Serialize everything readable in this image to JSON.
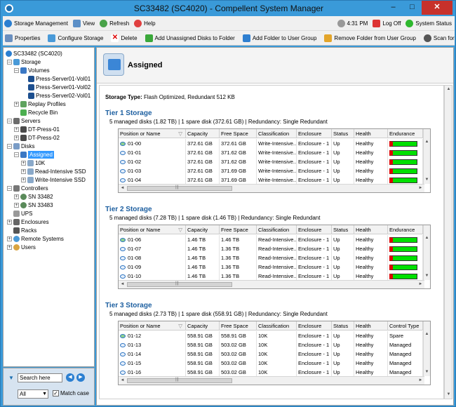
{
  "window": {
    "title": "SC33482 (SC4020) - Compellent System Manager"
  },
  "menu": {
    "storage_mgmt": "Storage Management",
    "view": "View",
    "refresh": "Refresh",
    "help": "Help",
    "time": "4:31 PM",
    "logoff": "Log Off",
    "system_status": "System Status"
  },
  "toolbar": {
    "properties": "Properties",
    "configure_storage": "Configure Storage",
    "delete": "Delete",
    "add_unassigned": "Add Unassigned Disks to Folder",
    "add_folder_user_group": "Add Folder to User Group",
    "remove_folder_user_group": "Remove Folder from User Group",
    "scan_disks": "Scan for Disks"
  },
  "tree": [
    {
      "label": "SC33482 (SC4020)",
      "icon": "system-icon"
    },
    {
      "label": "Storage",
      "icon": "storage-icon"
    },
    {
      "label": "Volumes",
      "icon": "folder-icon"
    },
    {
      "label": "Press-Server01-Vol01",
      "icon": "volume-icon"
    },
    {
      "label": "Press-Server01-Vol02",
      "icon": "volume-icon"
    },
    {
      "label": "Press-Server02-Vol01",
      "icon": "volume-icon"
    },
    {
      "label": "Replay Profiles",
      "icon": "replay-icon"
    },
    {
      "label": "Recycle Bin",
      "icon": "recycle-bin-icon"
    },
    {
      "label": "Servers",
      "icon": "servers-icon"
    },
    {
      "label": "DT-Press-01",
      "icon": "server-icon"
    },
    {
      "label": "DT-Press-02",
      "icon": "server-icon"
    },
    {
      "label": "Disks",
      "icon": "disks-icon"
    },
    {
      "label": "Assigned",
      "icon": "folder-icon"
    },
    {
      "label": "10K",
      "icon": "disk-class-icon"
    },
    {
      "label": "Read-Intensive SSD",
      "icon": "disk-class-icon"
    },
    {
      "label": "Write-Intensive SSD",
      "icon": "disk-class-icon"
    },
    {
      "label": "Controllers",
      "icon": "controllers-icon"
    },
    {
      "label": "SN 33482",
      "icon": "controller-icon"
    },
    {
      "label": "SN 33483",
      "icon": "controller-icon"
    },
    {
      "label": "UPS",
      "icon": "ups-icon"
    },
    {
      "label": "Enclosures",
      "icon": "enclosure-icon"
    },
    {
      "label": "Racks",
      "icon": "rack-icon"
    },
    {
      "label": "Remote Systems",
      "icon": "remote-icon"
    },
    {
      "label": "Users",
      "icon": "users-icon"
    }
  ],
  "search": {
    "value": "Search here",
    "scope": "All",
    "match_case": "Match case"
  },
  "main": {
    "title": "Assigned",
    "storage_type_label": "Storage Type:",
    "storage_type_value": "Flash Optimized, Redundant 512 KB"
  },
  "tiers": [
    {
      "name": "Tier 1 Storage",
      "summary": "5 managed disks (1.82 TB) | 1 spare disk (372.61 GB) | Redundancy: Single Redundant",
      "columns": [
        "Position or Name",
        "Capacity",
        "Free Space",
        "Classification",
        "Enclosure",
        "Status",
        "Health",
        "Endurance"
      ],
      "rows": [
        [
          "01-00",
          "372.61 GB",
          "372.61 GB",
          "Write-Intensive...",
          "Enclosure - 1",
          "Up",
          "Healthy",
          ""
        ],
        [
          "01-01",
          "372.61 GB",
          "371.62 GB",
          "Write-Intensive...",
          "Enclosure - 1",
          "Up",
          "Healthy",
          ""
        ],
        [
          "01-02",
          "372.61 GB",
          "371.62 GB",
          "Write-Intensive...",
          "Enclosure - 1",
          "Up",
          "Healthy",
          ""
        ],
        [
          "01-03",
          "372.61 GB",
          "371.69 GB",
          "Write-Intensive...",
          "Enclosure - 1",
          "Up",
          "Healthy",
          ""
        ],
        [
          "01-04",
          "372.61 GB",
          "371.69 GB",
          "Write-Intensive...",
          "Enclosure - 1",
          "Up",
          "Healthy",
          ""
        ]
      ]
    },
    {
      "name": "Tier 2 Storage",
      "summary": "5 managed disks (7.28 TB) | 1 spare disk (1.46 TB) | Redundancy: Single Redundant",
      "columns": [
        "Position or Name",
        "Capacity",
        "Free Space",
        "Classification",
        "Enclosure",
        "Status",
        "Health",
        "Endurance"
      ],
      "rows": [
        [
          "01-06",
          "1.46 TB",
          "1.46 TB",
          "Read-Intensive...",
          "Enclosure - 1",
          "Up",
          "Healthy",
          ""
        ],
        [
          "01-07",
          "1.46 TB",
          "1.36 TB",
          "Read-Intensive...",
          "Enclosure - 1",
          "Up",
          "Healthy",
          ""
        ],
        [
          "01-08",
          "1.46 TB",
          "1.36 TB",
          "Read-Intensive...",
          "Enclosure - 1",
          "Up",
          "Healthy",
          ""
        ],
        [
          "01-09",
          "1.46 TB",
          "1.36 TB",
          "Read-Intensive...",
          "Enclosure - 1",
          "Up",
          "Healthy",
          ""
        ],
        [
          "01-10",
          "1.46 TB",
          "1.36 TB",
          "Read-Intensive...",
          "Enclosure - 1",
          "Up",
          "Healthy",
          ""
        ]
      ]
    },
    {
      "name": "Tier 3 Storage",
      "summary": "5 managed disks (2.73 TB) | 1 spare disk (558.91 GB) | Redundancy: Single Redundant",
      "columns": [
        "Position or Name",
        "Capacity",
        "Free Space",
        "Classification",
        "Enclosure",
        "Status",
        "Health",
        "Control Type"
      ],
      "rows": [
        [
          "01-12",
          "558.91 GB",
          "558.91 GB",
          "10K",
          "Enclosure - 1",
          "Up",
          "Healthy",
          "Spare"
        ],
        [
          "01-13",
          "558.91 GB",
          "503.02 GB",
          "10K",
          "Enclosure - 1",
          "Up",
          "Healthy",
          "Managed"
        ],
        [
          "01-14",
          "558.91 GB",
          "503.02 GB",
          "10K",
          "Enclosure - 1",
          "Up",
          "Healthy",
          "Managed"
        ],
        [
          "01-15",
          "558.91 GB",
          "503.02 GB",
          "10K",
          "Enclosure - 1",
          "Up",
          "Healthy",
          "Managed"
        ],
        [
          "01-16",
          "558.91 GB",
          "503.02 GB",
          "10K",
          "Enclosure - 1",
          "Up",
          "Healthy",
          "Managed"
        ]
      ]
    }
  ],
  "colors": {
    "accent": "#3a9ad9",
    "tier_heading": "#1d5fa0",
    "selection": "#3399ff",
    "endurance_good": "#00e000",
    "endurance_bad": "#e00000"
  }
}
